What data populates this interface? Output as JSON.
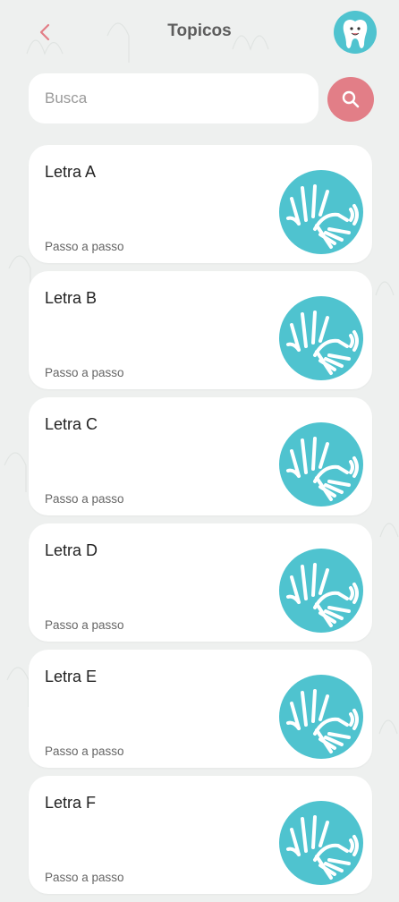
{
  "header": {
    "title": "Topicos",
    "back_icon": "chevron-left-icon",
    "avatar_icon": "tooth-icon"
  },
  "search": {
    "placeholder": "Busca",
    "value": "",
    "button_icon": "search-icon"
  },
  "colors": {
    "accent": "#e27e87",
    "brand_teal": "#4fc3cf",
    "background": "#eef0ef"
  },
  "topics": [
    {
      "title": "Letra A",
      "subtitle": "Passo a passo",
      "icon": "sign-language-hands-icon"
    },
    {
      "title": "Letra B",
      "subtitle": "Passo a passo",
      "icon": "sign-language-hands-icon"
    },
    {
      "title": "Letra C",
      "subtitle": "Passo a passo",
      "icon": "sign-language-hands-icon"
    },
    {
      "title": "Letra D",
      "subtitle": "Passo a passo",
      "icon": "sign-language-hands-icon"
    },
    {
      "title": "Letra E",
      "subtitle": "Passo a passo",
      "icon": "sign-language-hands-icon"
    },
    {
      "title": "Letra F",
      "subtitle": "Passo a passo",
      "icon": "sign-language-hands-icon"
    }
  ]
}
